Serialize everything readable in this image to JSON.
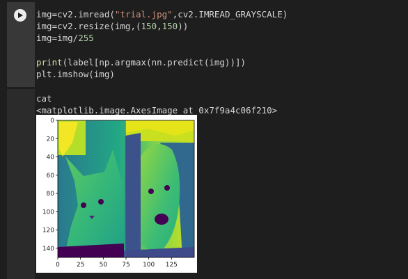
{
  "cell": {
    "code_lines": [
      [
        {
          "t": "img=cv2.imread("
        },
        {
          "t": "\"trial.jpg\"",
          "c": "str"
        },
        {
          "t": ",cv2.IMREAD_GRAYSCALE)"
        }
      ],
      [
        {
          "t": "img=cv2.resize(img,("
        },
        {
          "t": "150",
          "c": "num"
        },
        {
          "t": ","
        },
        {
          "t": "150",
          "c": "num"
        },
        {
          "t": "))"
        }
      ],
      [
        {
          "t": "img=img/"
        },
        {
          "t": "255",
          "c": "num"
        }
      ],
      [
        {
          "t": ""
        }
      ],
      [
        {
          "t": "print",
          "c": "kw"
        },
        {
          "t": "(label[np.argmax(nn.predict(img))])"
        }
      ],
      [
        {
          "t": "plt.imshow(img)"
        }
      ]
    ]
  },
  "output": {
    "line1": "cat",
    "line2": "<matplotlib.image.AxesImage at 0x7f9a4c06f210>"
  },
  "plot": {
    "y_ticks": [
      "0",
      "20",
      "40",
      "60",
      "80",
      "100",
      "120",
      "140"
    ],
    "x_ticks": [
      "0",
      "25",
      "50",
      "75",
      "100",
      "125"
    ]
  },
  "colors": {
    "run_button": "#ececec",
    "viridis_dark": "#440154",
    "viridis_mid": "#21918c",
    "viridis_light": "#fde725"
  }
}
